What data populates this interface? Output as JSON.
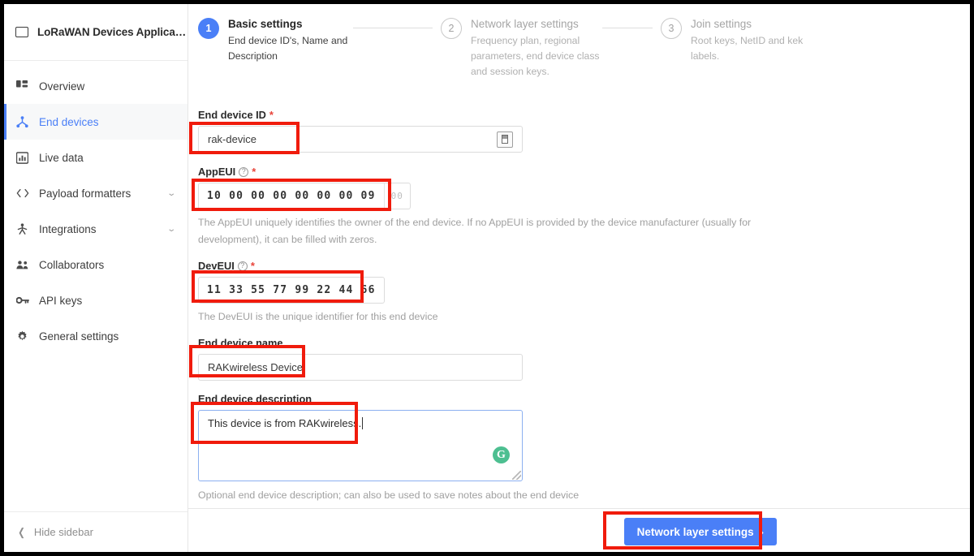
{
  "sidebar": {
    "app_title": "LoRaWAN Devices Applica…",
    "app_title_icon": "window-icon",
    "items": [
      {
        "label": "Overview",
        "icon": "grid-icon",
        "active": false,
        "expandable": false
      },
      {
        "label": "End devices",
        "icon": "device-tree-icon",
        "active": true,
        "expandable": false
      },
      {
        "label": "Live data",
        "icon": "bar-chart-icon",
        "active": false,
        "expandable": false
      },
      {
        "label": "Payload formatters",
        "icon": "code-brackets-icon",
        "active": false,
        "expandable": true
      },
      {
        "label": "Integrations",
        "icon": "integration-icon",
        "active": false,
        "expandable": true
      },
      {
        "label": "Collaborators",
        "icon": "people-icon",
        "active": false,
        "expandable": false
      },
      {
        "label": "API keys",
        "icon": "key-icon",
        "active": false,
        "expandable": false
      },
      {
        "label": "General settings",
        "icon": "gear-icon",
        "active": false,
        "expandable": false
      }
    ],
    "hide_sidebar_label": "Hide sidebar",
    "hide_sidebar_icon": "chevron-left-icon",
    "expand_icon": "chevron-down-icon"
  },
  "stepper": {
    "steps": [
      {
        "number": "1",
        "title": "Basic settings",
        "description": "End device ID's, Name and Description",
        "active": true
      },
      {
        "number": "2",
        "title": "Network layer settings",
        "description": "Frequency plan, regional parameters, end device class and session keys.",
        "active": false
      },
      {
        "number": "3",
        "title": "Join settings",
        "description": "Root keys, NetID and kek labels.",
        "active": false
      }
    ]
  },
  "form": {
    "end_device_id": {
      "label": "End device ID",
      "required": true,
      "value": "rak-device",
      "placeholder": "",
      "generate_icon": "generate-icon"
    },
    "app_eui": {
      "label": "AppEUI",
      "required": true,
      "help_icon": "question-mark-icon",
      "value": "10 00 00 00 00 00 00 09",
      "ghost": "00",
      "hint": "The AppEUI uniquely identifies the owner of the end device. If no AppEUI is provided by the device manufacturer (usually for development), it can be filled with zeros."
    },
    "dev_eui": {
      "label": "DevEUI",
      "required": true,
      "help_icon": "question-mark-icon",
      "value": "11 33 55 77 99 22 44 66",
      "hint": "The DevEUI is the unique identifier for this end device"
    },
    "end_device_name": {
      "label": "End device name",
      "required": false,
      "value": "RAKwireless Device",
      "placeholder": ""
    },
    "end_device_description": {
      "label": "End device description",
      "required": false,
      "value": "This device is from RAKwireless.",
      "placeholder": "",
      "hint": "Optional end device description; can also be used to save notes about the end device",
      "grammarly_icon": "grammarly-icon",
      "grammarly_glyph": "G",
      "resize_icon": "resize-grip-icon"
    }
  },
  "footer": {
    "next_button_label": "Network layer settings",
    "next_button_icon": "chevron-right-icon",
    "next_button_glyph": "›"
  },
  "colors": {
    "accent": "#4a7ff7",
    "required": "#e8443a",
    "annotation": "#f01b0c",
    "grammarly": "#4dbf91"
  }
}
